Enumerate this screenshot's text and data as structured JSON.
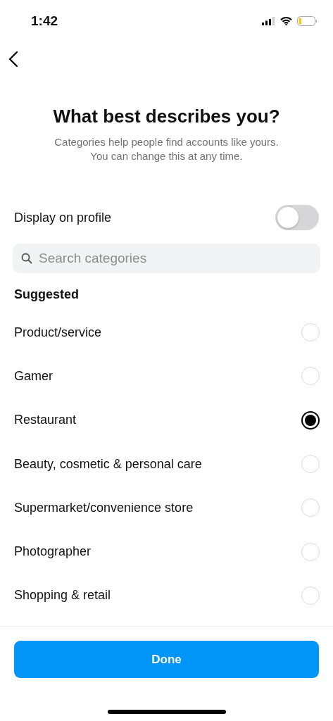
{
  "status_bar": {
    "time": "1:42"
  },
  "title": "What best describes you?",
  "subtitle": "Categories help people find accounts like yours. You can change this at any time.",
  "display_on_profile": {
    "label": "Display on profile",
    "on": false
  },
  "search": {
    "placeholder": "Search categories"
  },
  "section": "Suggested",
  "categories": [
    {
      "label": "Product/service",
      "selected": false
    },
    {
      "label": "Gamer",
      "selected": false
    },
    {
      "label": "Restaurant",
      "selected": true
    },
    {
      "label": "Beauty, cosmetic & personal care",
      "selected": false
    },
    {
      "label": "Supermarket/convenience store",
      "selected": false
    },
    {
      "label": "Photographer",
      "selected": false
    },
    {
      "label": "Shopping & retail",
      "selected": false
    }
  ],
  "button": "Done"
}
